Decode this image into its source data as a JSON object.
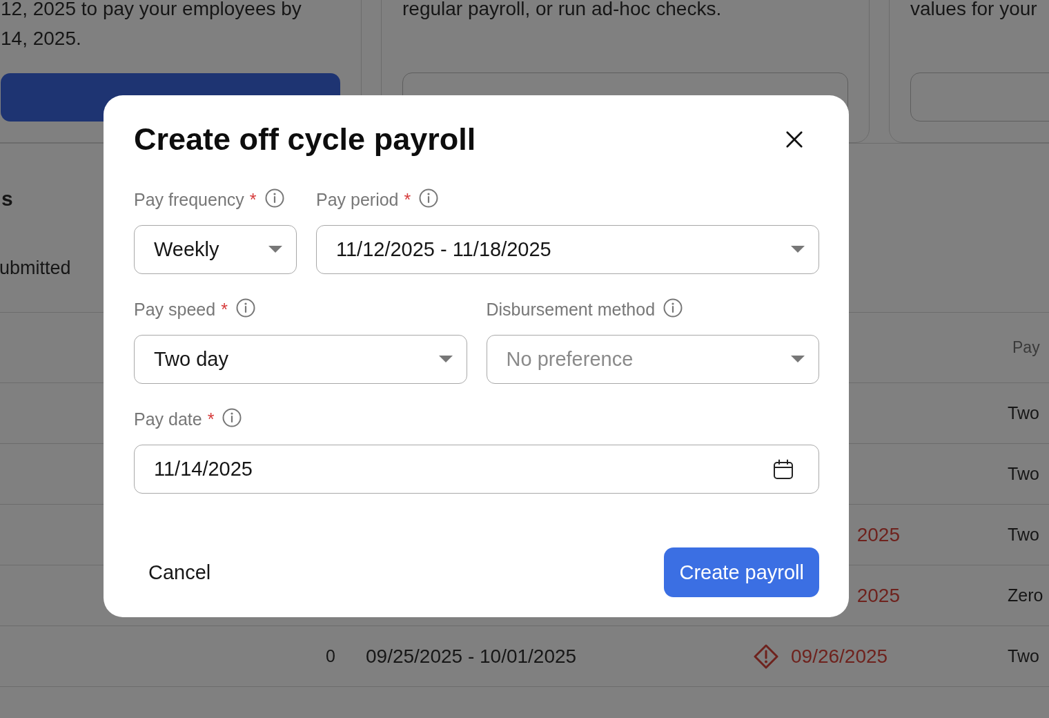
{
  "background": {
    "cards": [
      {
        "text": [
          "12, 2025 to pay your employees by",
          "14, 2025."
        ],
        "button": {
          "kind": "primary"
        }
      },
      {
        "text": [
          "regular payroll, or run ad-hoc checks."
        ],
        "button": {
          "kind": "outline"
        }
      },
      {
        "text": [
          "values for your"
        ],
        "button": {
          "kind": "outline"
        }
      }
    ],
    "section_title": "s",
    "section_subtitle": "ubmitted",
    "table": {
      "columns": [
        {
          "label": "Pay"
        }
      ],
      "rows": [
        {
          "speed": "Two"
        },
        {
          "speed": "Two"
        },
        {
          "pay_date": {
            "text": "2025",
            "overdue": true,
            "kind": "partial"
          },
          "speed": "Two"
        },
        {
          "pay_date": {
            "text": "2025",
            "overdue": true,
            "kind": "partial"
          },
          "speed": "Zero"
        },
        {
          "count": "0",
          "period": "09/25/2025 - 10/01/2025",
          "pay_date": {
            "text": "09/26/2025",
            "overdue": true,
            "kind": "full"
          },
          "speed": "Two"
        }
      ]
    }
  },
  "dialog": {
    "title": "Create off cycle payroll",
    "required_mark": "*",
    "fields": [
      {
        "label": "Pay frequency",
        "required": true,
        "kind": "select",
        "value": "Weekly"
      },
      {
        "label": "Pay period",
        "required": true,
        "kind": "select",
        "value": "11/12/2025 - 11/18/2025"
      },
      {
        "label": "Pay speed",
        "required": true,
        "kind": "select",
        "value": "Two day"
      },
      {
        "label": "Disbursement method",
        "required": false,
        "kind": "select",
        "placeholder": "No preference"
      },
      {
        "label": "Pay date",
        "required": true,
        "kind": "date",
        "value": "11/14/2025"
      }
    ],
    "cancel": "Cancel",
    "submit": "Create payroll"
  }
}
